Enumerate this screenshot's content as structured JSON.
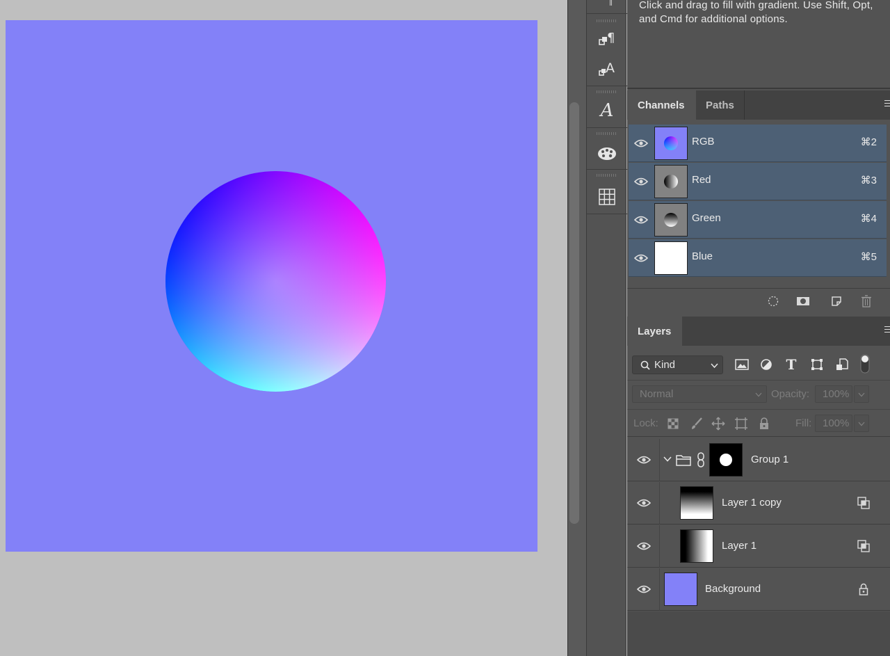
{
  "tool_hint": "Click and drag to fill with gradient.  Use Shift, Opt, and Cmd for additional options.",
  "colors": {
    "canvas_fill": "#8381f8",
    "selected_row": "#4d6075",
    "panel_bg": "#535353"
  },
  "tool_strip": [
    {
      "name": "paragraph-icon",
      "glyph": "¶"
    },
    {
      "name": "character-icon",
      "glyph": "A"
    },
    {
      "name": "glyphs-icon",
      "glyph": "𝒜"
    },
    {
      "name": "swatches-icon",
      "glyph": "palette"
    },
    {
      "name": "grid-icon",
      "glyph": "grid"
    }
  ],
  "channels_panel": {
    "tabs": [
      "Channels",
      "Paths"
    ],
    "channels": [
      {
        "name": "RGB",
        "shortcut": "⌘2",
        "visible": true
      },
      {
        "name": "Red",
        "shortcut": "⌘3",
        "visible": true
      },
      {
        "name": "Green",
        "shortcut": "⌘4",
        "visible": true
      },
      {
        "name": "Blue",
        "shortcut": "⌘5",
        "visible": true
      }
    ],
    "footer_icons": [
      "load-selection-icon",
      "save-selection-icon",
      "new-channel-icon",
      "delete-channel-icon"
    ]
  },
  "layers_panel": {
    "tab": "Layers",
    "filter": {
      "kind": "Kind"
    },
    "filter_icons": [
      "image-filter-icon",
      "adjustment-filter-icon",
      "type-filter-icon",
      "shape-filter-icon",
      "smart-object-filter-icon",
      "filter-toggle-icon"
    ],
    "blend_mode": "Normal",
    "opacity_label": "Opacity:",
    "opacity_value": "100%",
    "lock_label": "Lock:",
    "fill_label": "Fill:",
    "fill_value": "100%",
    "layers": [
      {
        "name": "Group 1",
        "type": "group",
        "visible": true,
        "expanded": true
      },
      {
        "name": "Layer 1 copy",
        "type": "layer",
        "visible": true,
        "clipped": true
      },
      {
        "name": "Layer 1",
        "type": "layer",
        "visible": true,
        "clipped": true
      },
      {
        "name": "Background",
        "type": "background",
        "visible": true,
        "locked": true
      }
    ]
  }
}
